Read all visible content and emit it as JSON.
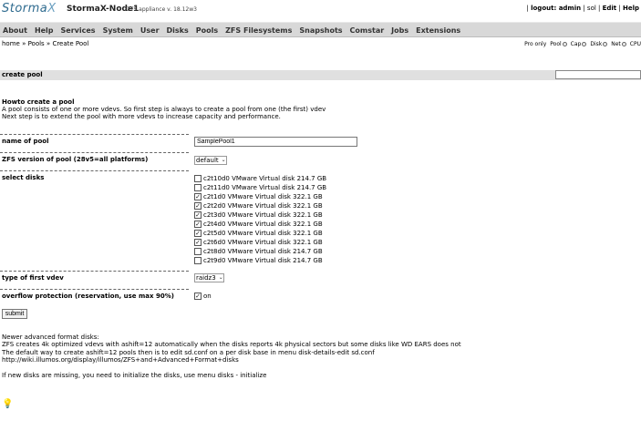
{
  "header": {
    "logo_main": "Storma",
    "logo_x": "X",
    "node_name": "StormaX-Node1",
    "version": "ZFS appliance v. 18.12w3",
    "logout": "logout: admin",
    "link_sol": "sol",
    "link_edit": "Edit",
    "link_help": "Help"
  },
  "nav": {
    "items": [
      "About",
      "Help",
      "Services",
      "System",
      "User",
      "Disks",
      "Pools",
      "ZFS Filesystems",
      "Snapshots",
      "Comstar",
      "Jobs",
      "Extensions"
    ]
  },
  "breadcrumb": "home » Pools » Create Pool",
  "right_links": {
    "pro_only": "Pro only",
    "pool": "Pool",
    "cap": "Cap",
    "disk": "Disk",
    "net": "Net",
    "cpu": "CPU"
  },
  "page_title": "create pool",
  "howto": {
    "heading": "Howto create a pool",
    "line1": "A pool consists of one or more vdevs. So first step is always to create a pool from one (the first) vdev",
    "line2": "Next step is to extend the pool with more vdevs to increase capacity and performance."
  },
  "form": {
    "name_label": "name of pool",
    "name_value": "SamplePool1",
    "zfs_version_label": "ZFS version of pool (28v5=all platforms)",
    "zfs_version_value": "default",
    "select_disks_label": "select disks",
    "disks": [
      {
        "label": "c2t10d0 VMware Virtual disk 214.7 GB",
        "checked": false
      },
      {
        "label": "c2t11d0 VMware Virtual disk 214.7 GB",
        "checked": false
      },
      {
        "label": "c2t1d0 VMware Virtual disk 322.1 GB",
        "checked": true
      },
      {
        "label": "c2t2d0 VMware Virtual disk 322.1 GB",
        "checked": true
      },
      {
        "label": "c2t3d0 VMware Virtual disk 322.1 GB",
        "checked": true
      },
      {
        "label": "c2t4d0 VMware Virtual disk 322.1 GB",
        "checked": true
      },
      {
        "label": "c2t5d0 VMware Virtual disk 322.1 GB",
        "checked": true
      },
      {
        "label": "c2t6d0 VMware Virtual disk 322.1 GB",
        "checked": true
      },
      {
        "label": "c2t8d0 VMware Virtual disk 214.7 GB",
        "checked": false
      },
      {
        "label": "c2t9d0 VMware Virtual disk 214.7 GB",
        "checked": false
      }
    ],
    "vdev_type_label": "type of first vdev",
    "vdev_type_value": "raidz3",
    "overflow_label": "overflow protection (reservation, use max 90%)",
    "overflow_checked": true,
    "overflow_value": "on",
    "submit_label": "submit"
  },
  "notes": {
    "line1": "Newer advanced format disks:",
    "line2": "ZFS creates 4k optimized vdevs with ashift=12 automatically when the disks reports 4k physical sectors but some disks like WD EARS does not",
    "line3": "The default way to create ashift=12 pools then is to edit sd.conf on a per disk base in menu disk-details-edit sd.conf",
    "line4": "http://wiki.illumos.org/display/illumos/ZFS+and+Advanced+Format+disks",
    "line5": "If new disks are missing, you need to initialize the disks, use menu disks - initialize"
  },
  "colors": {
    "nav_bg": "#d8d8d8",
    "title_bar_bg": "#e0e0e0",
    "logo": "#2f6b8f"
  }
}
